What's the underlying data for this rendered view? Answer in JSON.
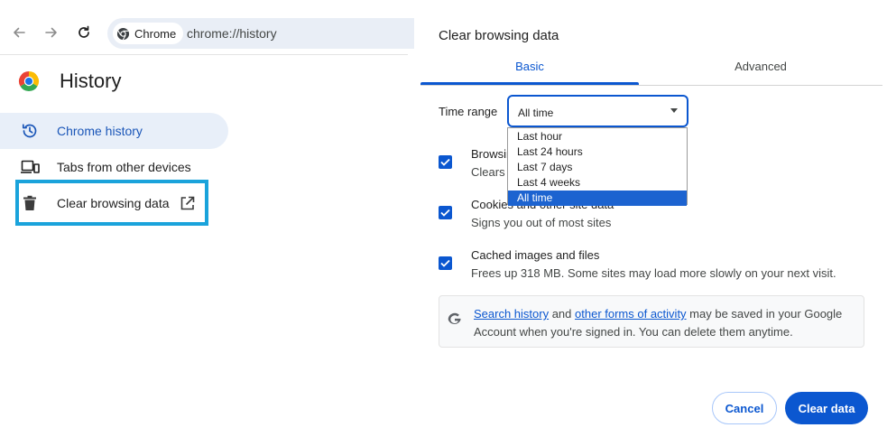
{
  "browser": {
    "chip_label": "Chrome",
    "url": "chrome://history"
  },
  "history_page": {
    "title": "History",
    "sidebar": {
      "items": [
        {
          "label": "Chrome history",
          "icon": "history-icon",
          "active": true
        },
        {
          "label": "Tabs from other devices",
          "icon": "devices-icon",
          "active": false
        },
        {
          "label": "Clear browsing data",
          "icon": "trash-icon",
          "trailing_icon": "open-in-new-icon",
          "active": false
        }
      ]
    }
  },
  "dialog": {
    "title": "Clear browsing data",
    "tabs": [
      {
        "label": "Basic",
        "selected": true
      },
      {
        "label": "Advanced",
        "selected": false
      }
    ],
    "time_range": {
      "label": "Time range",
      "value": "All time",
      "options": [
        "Last hour",
        "Last 24 hours",
        "Last 7 days",
        "Last 4 weeks",
        "All time"
      ],
      "selected_index": 4
    },
    "options": [
      {
        "title": "Browsing history",
        "visible_title": "Browsin",
        "description": "Clears history",
        "visible_description": "Clears l",
        "checked": true
      },
      {
        "title": "Cookies and other site data",
        "description": "Signs you out of most sites",
        "checked": true
      },
      {
        "title": "Cached images and files",
        "description": "Frees up 318 MB. Some sites may load more slowly on your next visit.",
        "checked": true
      }
    ],
    "info": {
      "link1": "Search history",
      "text1": " and ",
      "link2": "other forms of activity",
      "text2": " may be saved in your Google Account when you're signed in. You can delete them anytime."
    },
    "buttons": {
      "cancel": "Cancel",
      "clear": "Clear data"
    }
  },
  "colors": {
    "accent": "#0b57d0",
    "highlight_box": "#1aa3db",
    "active_item_bg": "#e8eff9"
  }
}
